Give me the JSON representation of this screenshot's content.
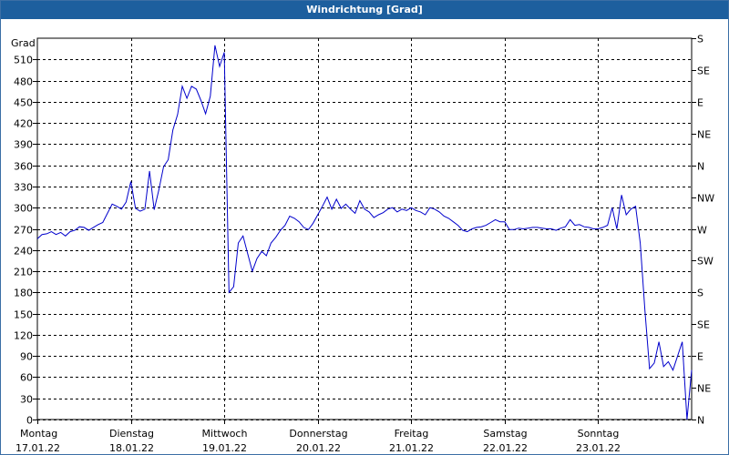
{
  "window": {
    "title": "Windrichtung [Grad]"
  },
  "chart_data": {
    "type": "line",
    "title": "Windrichtung [Grad]",
    "ylabel": "Grad",
    "ylim": [
      0,
      540
    ],
    "y_ticks": [
      0,
      30,
      60,
      90,
      120,
      150,
      180,
      210,
      240,
      270,
      300,
      330,
      360,
      390,
      420,
      450,
      480,
      510
    ],
    "y2_ticks": [
      {
        "value": 0,
        "label": "N"
      },
      {
        "value": 45,
        "label": "NE"
      },
      {
        "value": 90,
        "label": "E"
      },
      {
        "value": 135,
        "label": "SE"
      },
      {
        "value": 180,
        "label": "S"
      },
      {
        "value": 225,
        "label": "SW"
      },
      {
        "value": 270,
        "label": "W"
      },
      {
        "value": 315,
        "label": "NW"
      },
      {
        "value": 360,
        "label": "N"
      },
      {
        "value": 405,
        "label": "NE"
      },
      {
        "value": 450,
        "label": "E"
      },
      {
        "value": 495,
        "label": "SE"
      },
      {
        "value": 540,
        "label": "S"
      }
    ],
    "xlim": [
      0,
      7
    ],
    "x_ticks": [
      {
        "day": "Montag",
        "date": "17.01.22"
      },
      {
        "day": "Dienstag",
        "date": "18.01.22"
      },
      {
        "day": "Mittwoch",
        "date": "19.01.22"
      },
      {
        "day": "Donnerstag",
        "date": "20.01.22"
      },
      {
        "day": "Freitag",
        "date": "21.01.22"
      },
      {
        "day": "Samstag",
        "date": "22.01.22"
      },
      {
        "day": "Sonntag",
        "date": "23.01.22"
      }
    ],
    "grid": true,
    "color": "#0000cc",
    "series": [
      {
        "x": [
          0.0,
          0.05,
          0.1,
          0.15,
          0.2,
          0.25,
          0.3,
          0.35,
          0.4,
          0.45,
          0.5,
          0.55,
          0.6,
          0.65,
          0.7,
          0.75,
          0.8,
          0.85,
          0.9,
          0.95,
          1.0,
          1.05,
          1.1,
          1.15,
          1.2,
          1.25,
          1.3,
          1.35,
          1.4,
          1.45,
          1.5,
          1.55,
          1.6,
          1.65,
          1.7,
          1.75,
          1.8,
          1.85,
          1.9,
          1.95,
          2.0,
          2.05,
          2.1,
          2.15,
          2.2,
          2.25,
          2.3,
          2.35,
          2.4,
          2.45,
          2.5,
          2.55,
          2.6,
          2.65,
          2.7,
          2.75,
          2.8,
          2.85,
          2.9,
          2.95,
          3.0,
          3.05,
          3.1,
          3.15,
          3.2,
          3.25,
          3.3,
          3.35,
          3.4,
          3.45,
          3.5,
          3.55,
          3.6,
          3.65,
          3.7,
          3.75,
          3.8,
          3.85,
          3.9,
          3.95,
          4.0,
          4.05,
          4.1,
          4.15,
          4.2,
          4.25,
          4.3,
          4.35,
          4.4,
          4.45,
          4.5,
          4.55,
          4.6,
          4.65,
          4.7,
          4.75,
          4.8,
          4.85,
          4.9,
          4.95,
          5.0,
          5.05,
          5.1,
          5.15,
          5.2,
          5.25,
          5.3,
          5.35,
          5.4,
          5.45,
          5.5,
          5.55,
          5.6,
          5.65,
          5.7,
          5.75,
          5.8,
          5.85,
          5.9,
          5.95,
          6.0,
          6.05,
          6.1,
          6.15,
          6.2,
          6.25,
          6.3,
          6.35,
          6.4,
          6.45,
          6.5,
          6.55,
          6.6,
          6.65,
          6.7,
          6.75,
          6.8,
          6.85,
          6.9,
          6.95,
          7.0
        ],
        "y": [
          256,
          262,
          263,
          266,
          262,
          265,
          260,
          266,
          268,
          273,
          272,
          268,
          272,
          276,
          279,
          292,
          305,
          302,
          298,
          308,
          337,
          299,
          295,
          298,
          352,
          297,
          325,
          358,
          368,
          410,
          432,
          472,
          455,
          472,
          468,
          452,
          433,
          458,
          530,
          500,
          520,
          180,
          188,
          250,
          260,
          235,
          210,
          228,
          238,
          232,
          250,
          258,
          268,
          275,
          288,
          285,
          280,
          272,
          269,
          278,
          290,
          302,
          315,
          298,
          312,
          299,
          305,
          298,
          292,
          310,
          298,
          294,
          286,
          290,
          293,
          298,
          300,
          294,
          298,
          296,
          300,
          296,
          294,
          290,
          300,
          298,
          294,
          288,
          285,
          280,
          275,
          268,
          266,
          270,
          272,
          273,
          275,
          279,
          283,
          280,
          280,
          269,
          269,
          271,
          270,
          271,
          272,
          272,
          271,
          270,
          270,
          268,
          271,
          273,
          283,
          275,
          276,
          273,
          272,
          270,
          270,
          272,
          275,
          300,
          270,
          318,
          290,
          298,
          302,
          250,
          155,
          72,
          80,
          110,
          75,
          82,
          70,
          90,
          110,
          0,
          70
        ]
      }
    ]
  }
}
